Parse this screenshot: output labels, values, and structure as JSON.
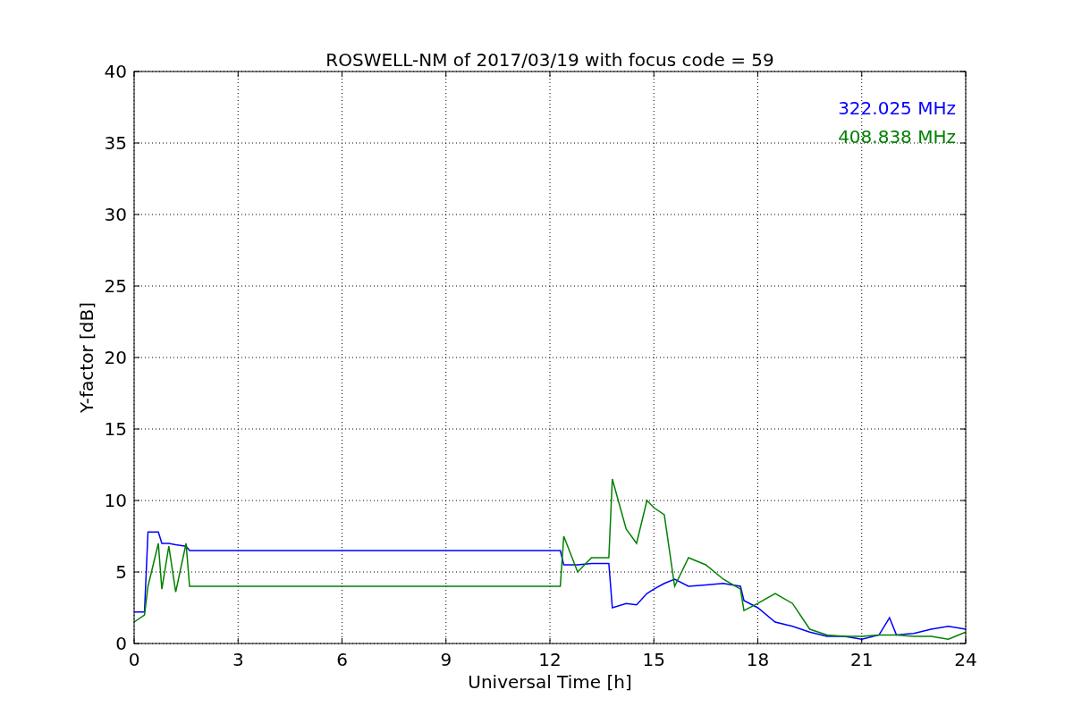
{
  "chart_data": {
    "type": "line",
    "title": "ROSWELL-NM of 2017/03/19 with focus code = 59",
    "xlabel": "Universal Time [h]",
    "ylabel": "Y-factor [dB]",
    "x": [
      0,
      0.3,
      0.4,
      0.7,
      0.8,
      1.0,
      1.2,
      1.5,
      1.6,
      12.3,
      12.4,
      12.8,
      13.2,
      13.7,
      13.8,
      14.2,
      14.5,
      14.8,
      15.0,
      15.3,
      15.6,
      16,
      16.5,
      17,
      17.5,
      17.6,
      18,
      18.5,
      19,
      19.5,
      20,
      20.5,
      21,
      21.5,
      21.8,
      22,
      22.5,
      23,
      23.5,
      24
    ],
    "series": [
      {
        "name": "322.025 MHz",
        "color": "#0000ff",
        "values": [
          2.2,
          2.2,
          7.8,
          7.8,
          7.0,
          7.0,
          6.9,
          6.8,
          6.5,
          6.5,
          5.5,
          5.5,
          5.6,
          5.6,
          2.5,
          2.8,
          2.7,
          3.5,
          3.8,
          4.2,
          4.5,
          4.0,
          4.1,
          4.2,
          4.0,
          3.0,
          2.5,
          1.5,
          1.2,
          0.8,
          0.5,
          0.5,
          0.3,
          0.6,
          1.8,
          0.6,
          0.7,
          1.0,
          1.2,
          1.0
        ]
      },
      {
        "name": "408.838 MHz",
        "color": "#008000",
        "values": [
          1.5,
          2.0,
          4.0,
          7.0,
          3.8,
          6.8,
          3.6,
          7.0,
          4.0,
          4.0,
          7.5,
          5.0,
          6.0,
          6.0,
          11.5,
          8.0,
          7.0,
          10.0,
          9.5,
          9.0,
          4.0,
          6.0,
          5.5,
          4.5,
          3.8,
          2.3,
          2.8,
          3.5,
          2.8,
          1.0,
          0.6,
          0.5,
          0.5,
          0.6,
          0.6,
          0.6,
          0.5,
          0.5,
          0.3,
          0.8
        ]
      }
    ],
    "grid": true,
    "xlim": [
      0,
      24
    ],
    "ylim": [
      0,
      40
    ],
    "xticks": [
      0,
      3,
      6,
      9,
      12,
      15,
      18,
      21,
      24
    ],
    "yticks": [
      0,
      5,
      10,
      15,
      20,
      25,
      30,
      35,
      40
    ]
  }
}
